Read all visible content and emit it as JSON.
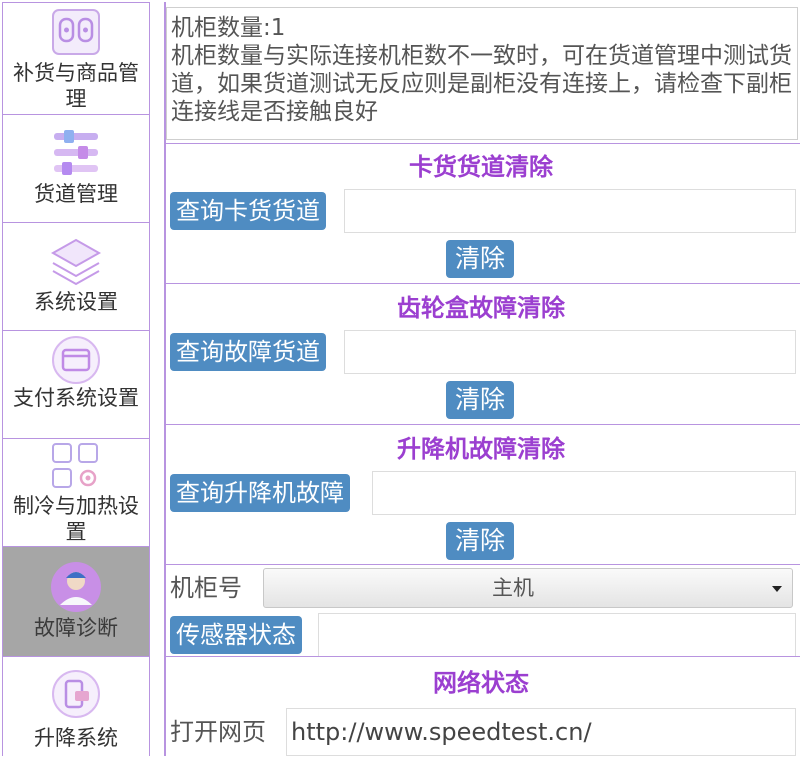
{
  "sidebar": {
    "items": [
      {
        "label": "补货与商品管理",
        "icon": "restock-icon",
        "active": false
      },
      {
        "label": "货道管理",
        "icon": "channel-icon",
        "active": false
      },
      {
        "label": "系统设置",
        "icon": "layers-icon",
        "active": false
      },
      {
        "label": "支付系统设置",
        "icon": "card-icon",
        "active": false
      },
      {
        "label": "制冷与加热设置",
        "icon": "grid-gear-icon",
        "active": false
      },
      {
        "label": "故障诊断",
        "icon": "technician-icon",
        "active": true
      },
      {
        "label": "升降系统",
        "icon": "lift-icon",
        "active": false
      }
    ]
  },
  "info": {
    "cabinet_count": "机柜数量:1",
    "notice": "机柜数量与实际连接机柜数不一致时，可在货道管理中测试货道，如果货道测试无反应则是副柜没有连接上，请检查下副柜连接线是否接触良好"
  },
  "stuck_section": {
    "title": "卡货货道清除",
    "query_label": "查询卡货货道",
    "result": "",
    "clear_label": "清除"
  },
  "gearbox_section": {
    "title": "齿轮盒故障清除",
    "query_label": "查询故障货道",
    "result": "",
    "clear_label": "清除"
  },
  "lift_section": {
    "title": "升降机故障清除",
    "query_label": "查询升降机故障",
    "result": "",
    "clear_label": "清除"
  },
  "cabinet": {
    "label": "机柜号",
    "selected": "主机",
    "sensor_label": "传感器状态",
    "sensor_result": ""
  },
  "network": {
    "title": "网络状态",
    "open_label": "打开网页",
    "url": "http://www.speedtest.cn/"
  },
  "colors": {
    "accent": "#9b3fd0",
    "button": "#4f8cc2",
    "border": "#b894e0",
    "active_bg": "#a6a6a6"
  }
}
